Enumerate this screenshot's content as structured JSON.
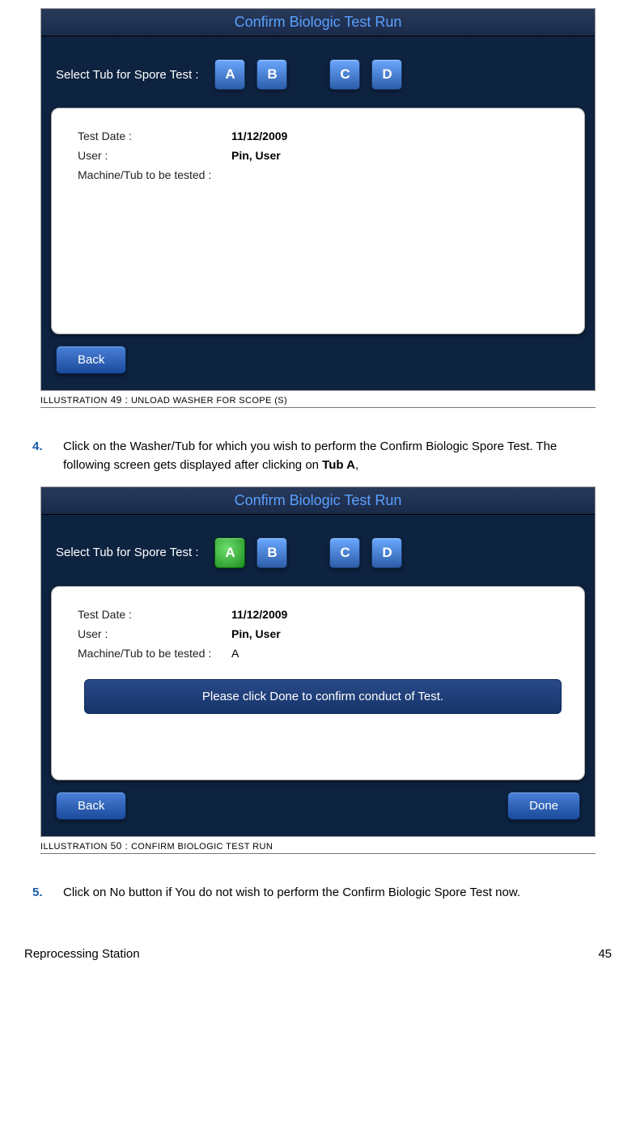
{
  "illustration49": {
    "caption_prefix": "Illustration",
    "caption_number": "49",
    "caption_text": "Unload Washer for Scope (s)",
    "title": "Confirm Biologic Test Run",
    "select_label": "Select Tub for Spore Test :",
    "tubs": {
      "a": "A",
      "b": "B",
      "c": "C",
      "d": "D"
    },
    "fields": {
      "test_date_lbl": "Test Date :",
      "test_date_val": "11/12/2009",
      "user_lbl": "User :",
      "user_val": "Pin, User",
      "machine_lbl": "Machine/Tub to be tested :",
      "machine_val": ""
    },
    "back": "Back"
  },
  "step4": {
    "num": "4.",
    "text_a": "Click on the Washer/Tub for which you wish to perform the Confirm Biologic Spore Test. The following screen gets displayed after clicking on ",
    "text_b": "Tub A",
    "text_c": ","
  },
  "illustration50": {
    "caption_prefix": "Illustration",
    "caption_number": "50",
    "caption_text": "Confirm Biologic Test Run",
    "title": "Confirm Biologic Test Run",
    "select_label": "Select Tub for Spore Test :",
    "tubs": {
      "a": "A",
      "b": "B",
      "c": "C",
      "d": "D"
    },
    "fields": {
      "test_date_lbl": "Test Date :",
      "test_date_val": "11/12/2009",
      "user_lbl": "User :",
      "user_val": "Pin, User",
      "machine_lbl": "Machine/Tub to be tested :",
      "machine_val": "A"
    },
    "confirm_msg": "Please click Done to confirm conduct of Test.",
    "back": "Back",
    "done": "Done"
  },
  "step5": {
    "num": "5.",
    "text": "Click on No button if You do not wish to perform the Confirm Biologic Spore Test now."
  },
  "footer": {
    "left": "Reprocessing Station",
    "right": "45"
  }
}
